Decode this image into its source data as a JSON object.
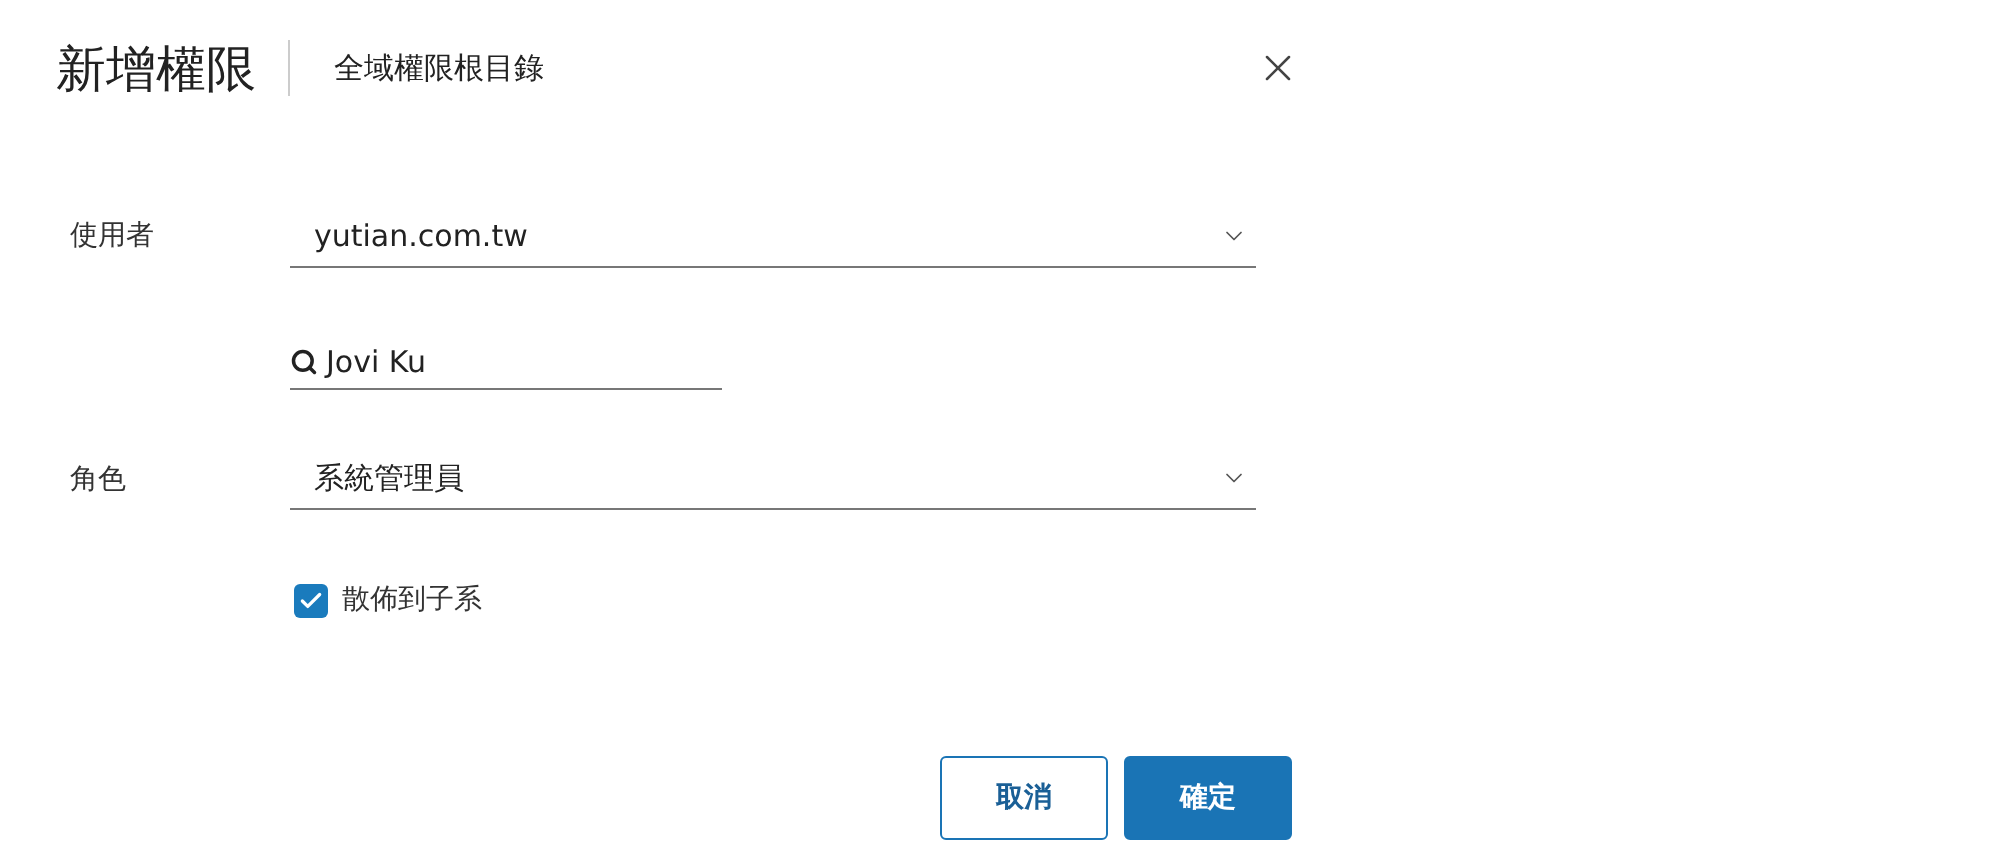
{
  "dialog": {
    "title": "新增權限",
    "subtitle": "全域權限根目錄"
  },
  "fields": [
    {
      "kind": "select",
      "label": "使用者",
      "value": "yutian.com.tw"
    },
    {
      "kind": "search",
      "value": "Jovi Ku"
    },
    {
      "kind": "select",
      "label": "角色",
      "value": "系統管理員"
    },
    {
      "kind": "checkbox",
      "label": "散佈到子系",
      "checked": true
    }
  ],
  "buttons": [
    {
      "label": "取消",
      "kind": "secondary"
    },
    {
      "label": "確定",
      "kind": "primary"
    }
  ]
}
